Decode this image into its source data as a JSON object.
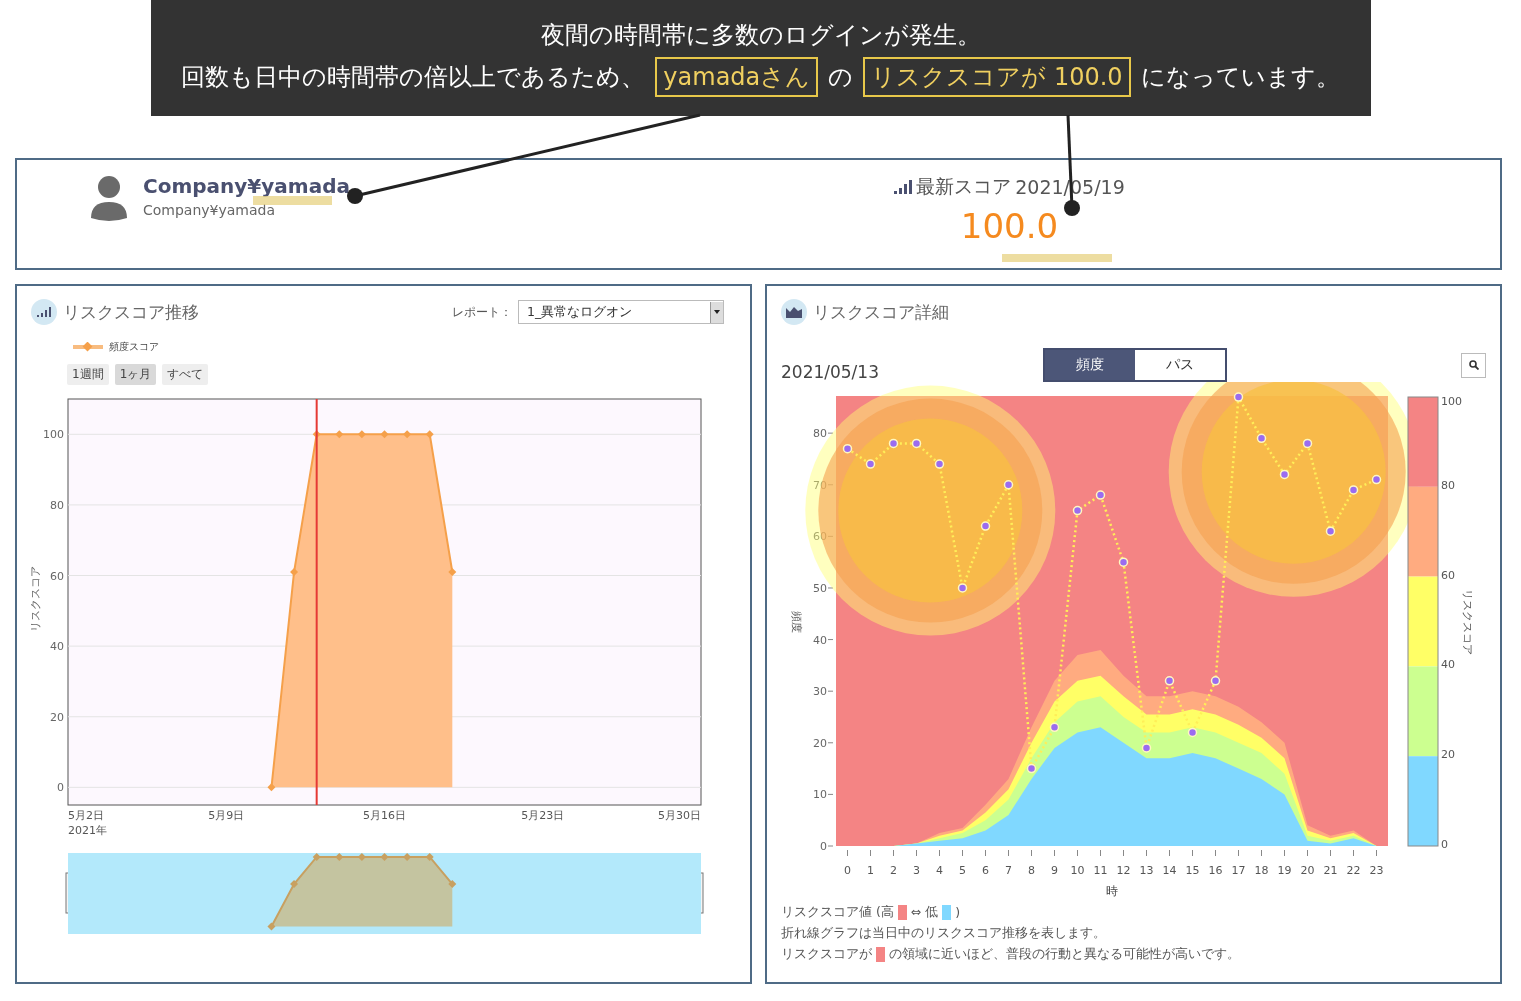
{
  "callout": {
    "line1": "夜間の時間帯に多数のログインが発生。",
    "line2": [
      {
        "text": "回数も日中の時間帯の倍以上であるため、",
        "highlighted": false
      },
      {
        "text": "yamadaさん",
        "highlighted": true
      },
      {
        "text": "の",
        "highlighted": false
      },
      {
        "text": "リスクスコアが 100.0",
        "highlighted": true
      },
      {
        "text": "になっています。",
        "highlighted": false
      }
    ]
  },
  "user": {
    "name": "Company¥yamada",
    "account": "Company¥yamada"
  },
  "latest_score": {
    "label": "最新スコア",
    "date": "2021/05/19",
    "value": "100.0"
  },
  "trend_panel": {
    "title": "リスクスコア推移",
    "report_label": "レポート：",
    "report_value": "1_異常なログオン",
    "ranges": [
      {
        "label": "1週間",
        "selected": false
      },
      {
        "label": "1ヶ月",
        "selected": true
      },
      {
        "label": "すべて",
        "selected": false
      }
    ],
    "chart_data": {
      "type": "area",
      "ylabel": "リスクスコア",
      "xlabel": "2021年",
      "ylim": [
        -5,
        110
      ],
      "categories": [
        "5月2日",
        null,
        null,
        null,
        null,
        null,
        null,
        "5月9日",
        null,
        null,
        null,
        null,
        null,
        null,
        "5月16日",
        null,
        null,
        null,
        null,
        null,
        null,
        "5月23日",
        null,
        null,
        null,
        null,
        null,
        null,
        "5月30日"
      ],
      "yticks": [
        0,
        20,
        40,
        60,
        80,
        100
      ],
      "grid": true,
      "series": [
        {
          "name": "頻度スコア",
          "color": "#f5a04a",
          "marker": "diamond",
          "values": [
            null,
            null,
            null,
            null,
            null,
            null,
            null,
            null,
            null,
            0,
            61,
            100,
            100,
            100,
            100,
            100,
            100,
            61,
            null,
            null,
            null,
            null,
            null,
            null,
            null,
            null,
            null,
            null,
            null
          ]
        }
      ]
    }
  },
  "detail_panel": {
    "title": "リスクスコア詳細",
    "date": "2021/05/13",
    "modes": [
      {
        "label": "頻度",
        "selected": true
      },
      {
        "label": "パス",
        "selected": false
      }
    ],
    "chart_data": {
      "type": "area",
      "stacked": true,
      "xlabel": "時",
      "ylabel": "頻度",
      "xlim": [
        -0.5,
        23.5
      ],
      "ylim": [
        0,
        87.2
      ],
      "xticks": [
        0,
        1,
        2,
        3,
        4,
        5,
        6,
        7,
        8,
        9,
        10,
        11,
        12,
        13,
        14,
        15,
        16,
        17,
        18,
        19,
        20,
        21,
        22,
        23
      ],
      "yticks": [
        0,
        10,
        20,
        30,
        40,
        50,
        60,
        70,
        80
      ],
      "x": [
        0,
        1,
        2,
        3,
        4,
        5,
        6,
        7,
        8,
        9,
        10,
        11,
        12,
        13,
        14,
        15,
        16,
        17,
        18,
        19,
        20,
        21,
        22,
        23
      ],
      "series": [
        {
          "color": "#80d8ff",
          "values": [
            0,
            0,
            0,
            0.5,
            1,
            1.5,
            3,
            6,
            13,
            19,
            22,
            23,
            20,
            17,
            17,
            18,
            17,
            15,
            13,
            10,
            1,
            0.5,
            1.5,
            0
          ]
        },
        {
          "color": "#ccff90",
          "values": [
            0,
            0,
            0,
            0,
            0.5,
            1,
            2,
            3,
            4,
            5,
            6,
            6,
            5,
            5,
            5,
            5,
            5,
            5,
            5,
            4,
            1,
            0.5,
            0.5,
            0
          ]
        },
        {
          "color": "#ffff66",
          "values": [
            0,
            0,
            0,
            0,
            0.5,
            0.5,
            1.5,
            2,
            3,
            4,
            4,
            4,
            4,
            3.5,
            3.5,
            3.5,
            3.5,
            3.5,
            3,
            3,
            1,
            0.5,
            0.5,
            0
          ]
        },
        {
          "color": "#ffab80",
          "values": [
            0,
            0,
            0,
            0,
            0.5,
            0.5,
            1.5,
            2,
            3,
            4,
            5,
            5,
            4,
            3.5,
            3.5,
            3.5,
            3.5,
            3.5,
            3,
            3,
            1,
            0.5,
            0.5,
            0
          ]
        },
        {
          "type": "line",
          "color": "#ffee58",
          "line_style": "dotted",
          "marker": "circle",
          "values": [
            77,
            74,
            78,
            78,
            74,
            50,
            62,
            70,
            15,
            23,
            65,
            68,
            55,
            19,
            32,
            22,
            32,
            87,
            79,
            72,
            78,
            61,
            69,
            71
          ]
        }
      ]
    },
    "colorbar": {
      "title": "リスクスコア",
      "ticks": [
        "100",
        "80",
        "60",
        "40",
        "20",
        "0"
      ],
      "segments": [
        {
          "color": "#f48484"
        },
        {
          "color": "#ffab80"
        },
        {
          "color": "#ffff66"
        },
        {
          "color": "#ccff90"
        },
        {
          "color": "#80d8ff"
        }
      ]
    },
    "notes": [
      [
        {
          "kind": "text",
          "text": "リスクスコア値 (高"
        },
        {
          "kind": "swatch",
          "color": "#f48484"
        },
        {
          "kind": "text",
          "text": "⇔ 低"
        },
        {
          "kind": "swatch",
          "color": "#80d8ff"
        },
        {
          "kind": "text",
          "text": ")"
        }
      ],
      [
        {
          "kind": "text",
          "text": "折れ線グラフは当日中のリスクスコア推移を表します。"
        }
      ],
      [
        {
          "kind": "text",
          "text": "リスクスコアが"
        },
        {
          "kind": "swatch",
          "color": "#f48484"
        },
        {
          "kind": "text",
          "text": "の領域に近いほど、普段の行動と異なる可能性が高いです。"
        }
      ]
    ]
  }
}
